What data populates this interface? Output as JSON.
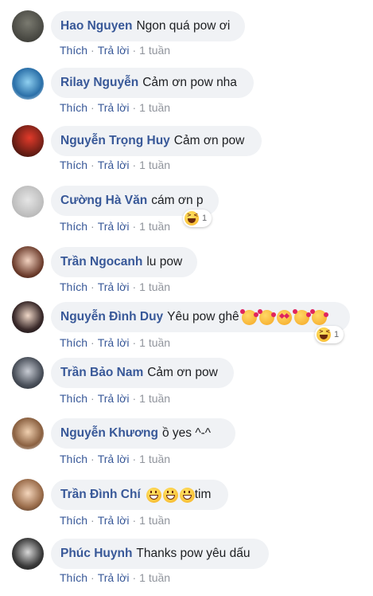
{
  "actions": {
    "like": "Thích",
    "reply": "Trả lời",
    "sep": "·",
    "time": "1 tuần"
  },
  "comments": [
    {
      "author": "Hao Nguyen",
      "text": "Ngon quá pow ơi"
    },
    {
      "author": "Rilay Nguyễn",
      "text": "Cảm ơn pow nha"
    },
    {
      "author": "Nguyễn Trọng Huy",
      "text": "Cảm ơn pow"
    },
    {
      "author": "Cường Hà Văn",
      "text": "cám ơn p",
      "reaction_count": "1"
    },
    {
      "author": "Trần Ngocanh",
      "text": "lu pow"
    },
    {
      "author": "Nguyễn Đình Duy",
      "text": "Yêu pow ghê",
      "reaction_count": "1"
    },
    {
      "author": "Trần Bảo Nam",
      "text": "Cảm ơn pow"
    },
    {
      "author": "Nguyễn Khương",
      "text": "ồ yes ^-^"
    },
    {
      "author": "Trần Đình Chí",
      "text": "tim"
    },
    {
      "author": "Phúc Huynh",
      "text": "Thanks pow yêu dấu"
    }
  ],
  "colors": {
    "author": "#385898",
    "bubble": "#f0f2f5",
    "meta": "#90949c"
  }
}
